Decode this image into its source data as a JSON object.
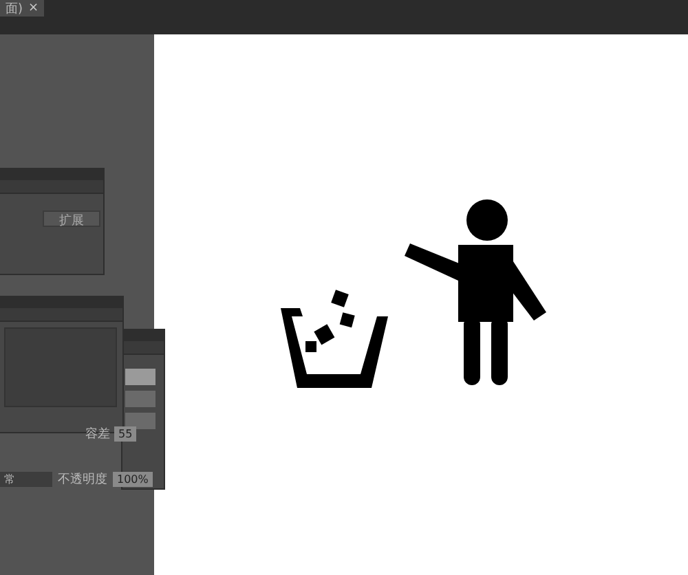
{
  "document_tab": {
    "title": "面)",
    "close": "×"
  },
  "pathfinder_panel": {
    "expand_button": "扩展"
  },
  "magic_panel": {
    "tolerance_label": "容差",
    "tolerance_value": "55"
  },
  "transparency": {
    "blend_mode": "常",
    "opacity_label": "不透明度",
    "opacity_value": "100%"
  }
}
